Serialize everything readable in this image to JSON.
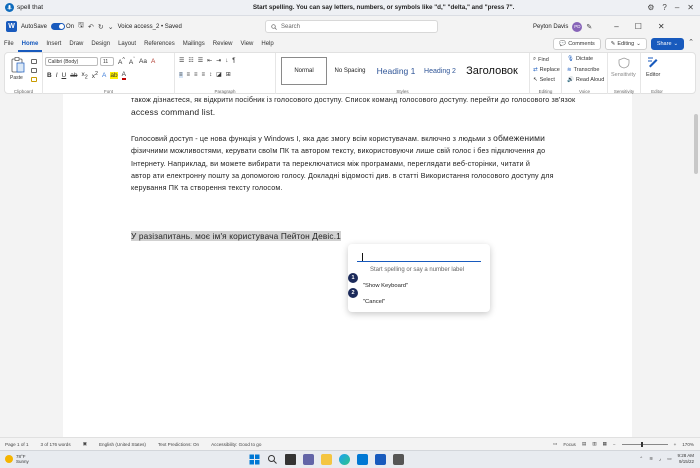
{
  "voice_bar": {
    "heard": "spell that",
    "message": "Start spelling. You can say letters, numbers, or symbols like \"d,\" \"delta,\" and \"press 7\"."
  },
  "title_bar": {
    "autosave_label": "AutoSave",
    "autosave_state": "On",
    "doc_name": "Voice access_2 • Saved",
    "search_placeholder": "Search",
    "user_name": "Peyton Davis",
    "user_initials": "PD"
  },
  "tabs": [
    "File",
    "Home",
    "Insert",
    "Draw",
    "Design",
    "Layout",
    "References",
    "Mailings",
    "Review",
    "View",
    "Help"
  ],
  "active_tab": "Home",
  "tab_buttons": {
    "comments": "Comments",
    "editing": "Editing",
    "share": "Share"
  },
  "ribbon": {
    "paste_label": "Paste",
    "font_name": "Calibri (Body)",
    "font_size": "11",
    "styles": [
      {
        "label": "Normal",
        "selected": true
      },
      {
        "label": "No Spacing",
        "selected": false
      },
      {
        "label": "Heading 1",
        "selected": false
      },
      {
        "label": "Heading 2",
        "selected": false
      },
      {
        "label": "Заголовок",
        "selected": false
      }
    ],
    "editing": {
      "find": "Find",
      "replace": "Replace",
      "select": "Select"
    },
    "voice": {
      "dictate": "Dictate",
      "transcribe": "Transcribe",
      "read_aloud": "Read Aloud"
    },
    "sensitivity_label": "Sensitivity",
    "editor_label": "Editor",
    "groups": {
      "clipboard": "Clipboard",
      "font": "Font",
      "paragraph": "Paragraph",
      "styles": "Styles",
      "editing": "Editing",
      "voice": "Voice",
      "sensitivity": "Sensitivity",
      "editor": "Editor"
    }
  },
  "document": {
    "para1_line1": "також дізнаєтеся, як відкрити посібник із голосового доступу. Список команд голосового доступу. перейти до голосового зв'язок",
    "para1_line2": "access command list.",
    "para2_line1_a": "Голосовий доступ - це нова функція у Windows I, яка дає змогу всім користувачам. включно з людьми з ",
    "para2_line1_b": "обмеженими",
    "para2_line2": "фізичними можливостями, керувати своїм ПК та автором тексту, використовуючи лише свій голос і без підключення до",
    "para2_line3": "Інтернету. Наприклад, ви можете вибирати та переключатися між програмами, переглядати веб-сторінки, читати й",
    "para2_line4": "автор ати електронну пошту за допомогою голосу. Докладні відомості див. в статті Використання голосового доступу для",
    "para2_line5": "керування ПК та створення тексту голосом.",
    "para3": "У разізапитань. моє ім'я користувача Пейтон Девіс.",
    "para3_mark": "1"
  },
  "spell_overlay": {
    "hint": "Start spelling or say a number label",
    "options": [
      {
        "num": "1",
        "label": "\"Show Keyboard\""
      },
      {
        "num": "2",
        "label": "\"Cancel\""
      }
    ]
  },
  "status_bar": {
    "page": "Page 1 of 1",
    "words": "3 of 176 words",
    "language": "English (United States)",
    "predictions": "Text Predictions: On",
    "accessibility": "Accessibility: Good to go",
    "focus": "Focus",
    "zoom": "170%"
  },
  "taskbar": {
    "temp": "78°F",
    "weather": "Sunny",
    "time": "9:28 AM",
    "date": "9/15/22"
  }
}
